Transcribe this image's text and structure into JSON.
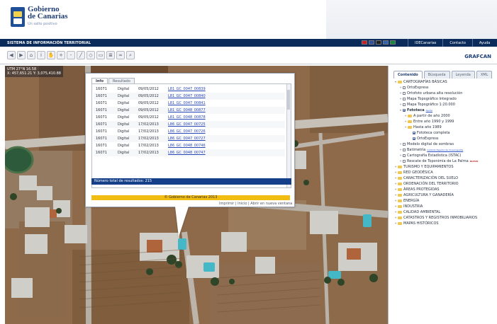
{
  "header": {
    "logo_title1": "Gobierno",
    "logo_title2": "de Canarias",
    "logo_subtitle": "Un salto positivo"
  },
  "navbar": {
    "title": "SISTEMA DE INFORMACIÓN TERRITORIAL",
    "flags": [
      "es-flag",
      "uk-flag",
      "de-flag",
      "fr-flag",
      "it-flag"
    ],
    "links": [
      "IDECanarias",
      "Contacto",
      "Ayuda"
    ]
  },
  "toolbar": {
    "tools": [
      {
        "icon": "back-icon",
        "glyph": "◀"
      },
      {
        "icon": "forward-icon",
        "glyph": "▶"
      },
      {
        "icon": "home-icon",
        "glyph": "⌂"
      },
      {
        "icon": "info-icon",
        "glyph": "i"
      },
      {
        "icon": "pan-icon",
        "glyph": "✋"
      },
      {
        "icon": "zoom-in-icon",
        "glyph": "+"
      },
      {
        "icon": "zoom-out-icon",
        "glyph": "-"
      },
      {
        "icon": "measure-icon",
        "glyph": "╱"
      },
      {
        "icon": "area-icon",
        "glyph": "◇"
      },
      {
        "icon": "print-icon",
        "glyph": "▭"
      },
      {
        "icon": "layers-icon",
        "glyph": "≣"
      },
      {
        "icon": "link-icon",
        "glyph": "∞"
      },
      {
        "icon": "search-icon",
        "glyph": "⌕"
      }
    ],
    "brand": "GRAFCAN"
  },
  "map": {
    "coordinates_line1": "UTM 27°N 16.58",
    "coordinates_line2": "X: 457,651.21  Y: 3,075,410.88"
  },
  "popup": {
    "tabs": [
      "Info",
      "Resultado"
    ],
    "active_tab": 0,
    "rows": [
      [
        "16071",
        "Digital",
        "09/05/2012",
        "L81_GC_0047_00839"
      ],
      [
        "16071",
        "Digital",
        "09/05/2012",
        "L81_GC_0047_00840"
      ],
      [
        "16071",
        "Digital",
        "09/05/2012",
        "L81_GC_0047_00841"
      ],
      [
        "16071",
        "Digital",
        "09/05/2012",
        "L81_GC_0048_00877"
      ],
      [
        "16071",
        "Digital",
        "09/05/2012",
        "L81_GC_0048_00878"
      ],
      [
        "16071",
        "Digital",
        "17/02/2013",
        "L86_GC_0047_00725"
      ],
      [
        "16071",
        "Digital",
        "17/02/2013",
        "L86_GC_0047_00726"
      ],
      [
        "16071",
        "Digital",
        "17/02/2013",
        "L86_GC_0047_00727"
      ],
      [
        "16071",
        "Digital",
        "17/02/2013",
        "L86_GC_0048_00746"
      ],
      [
        "16071",
        "Digital",
        "17/02/2013",
        "L86_GC_0048_00747"
      ]
    ],
    "total_label": "Número total de resultados: 215",
    "copyright": "© Gobierno de Canarias 2013",
    "links": "Imprimir | Inicio | Abrir en nueva ventana"
  },
  "right_panel": {
    "tabs": [
      "Contenido",
      "Búsqueda",
      "Leyenda",
      "XML"
    ],
    "active_tab": 0,
    "items": [
      {
        "depth": 0,
        "type": "folder",
        "label": "CARTOGRAFÍAS BÁSICAS",
        "expander": "▾"
      },
      {
        "depth": 1,
        "type": "check",
        "checked": false,
        "label": "OrtoExpress",
        "expander": "+"
      },
      {
        "depth": 1,
        "type": "check",
        "checked": false,
        "label": "Ortofoto urbana alta resolución",
        "expander": "+"
      },
      {
        "depth": 1,
        "type": "check",
        "checked": false,
        "label": "Mapa Topográfico Integrado",
        "expander": "+"
      },
      {
        "depth": 1,
        "type": "check",
        "checked": false,
        "label": "Mapa Topográfico 1:20.000",
        "expander": "+"
      },
      {
        "depth": 1,
        "type": "check",
        "checked": true,
        "label": "Fototeca",
        "expander": "▾",
        "link": "Ayuda",
        "bold": true
      },
      {
        "depth": 2,
        "type": "folder",
        "label": "A partir de año 2000",
        "expander": "+"
      },
      {
        "depth": 2,
        "type": "folder",
        "label": "Entre año 1990 y 1999",
        "expander": "+"
      },
      {
        "depth": 2,
        "type": "folder",
        "label": "Hasta año 1989",
        "expander": "+"
      },
      {
        "depth": 3,
        "type": "check",
        "checked": true,
        "label": "Fototeca completa",
        "expander": ""
      },
      {
        "depth": 3,
        "type": "check",
        "checked": true,
        "label": "OrtoExpress",
        "expander": ""
      },
      {
        "depth": 1,
        "type": "check",
        "checked": false,
        "label": "Modelo digital de sombras",
        "expander": "+"
      },
      {
        "depth": 1,
        "type": "check",
        "checked": false,
        "label": "Batimetría",
        "expander": "+",
        "link": "Instituto Español de Oceanografía"
      },
      {
        "depth": 1,
        "type": "check",
        "checked": false,
        "label": "Cartografía Estadística (ISTAC)",
        "expander": "+"
      },
      {
        "depth": 1,
        "type": "check",
        "checked": false,
        "label": "Rescate de Toponimia de La Palma",
        "expander": "+",
        "new": "NUEVO"
      },
      {
        "depth": 0,
        "type": "folder",
        "label": "TURISMO Y EQUIPAMIENTOS",
        "expander": "+"
      },
      {
        "depth": 0,
        "type": "folder",
        "label": "RED GEODÉSICA",
        "expander": "+"
      },
      {
        "depth": 0,
        "type": "folder",
        "label": "CARACTERIZACIÓN DEL SUELO",
        "expander": "+"
      },
      {
        "depth": 0,
        "type": "folder",
        "label": "ORDENACIÓN DEL TERRITORIO",
        "expander": "+"
      },
      {
        "depth": 0,
        "type": "folder",
        "label": "ÁREAS PROTEGIDAS",
        "expander": "+"
      },
      {
        "depth": 0,
        "type": "folder",
        "label": "AGRICULTURA Y GANADERÍA",
        "expander": "+"
      },
      {
        "depth": 0,
        "type": "folder",
        "label": "ENERGÍA",
        "expander": "+"
      },
      {
        "depth": 0,
        "type": "folder",
        "label": "INDUSTRIA",
        "expander": "+"
      },
      {
        "depth": 0,
        "type": "folder",
        "label": "CALIDAD AMBIENTAL",
        "expander": "+"
      },
      {
        "depth": 0,
        "type": "folder",
        "label": "CATASTROS Y REGISTROS INMOBILIARIOS",
        "expander": "+"
      },
      {
        "depth": 0,
        "type": "folder",
        "label": "MAPAS HISTÓRICOS",
        "expander": "+"
      }
    ]
  }
}
